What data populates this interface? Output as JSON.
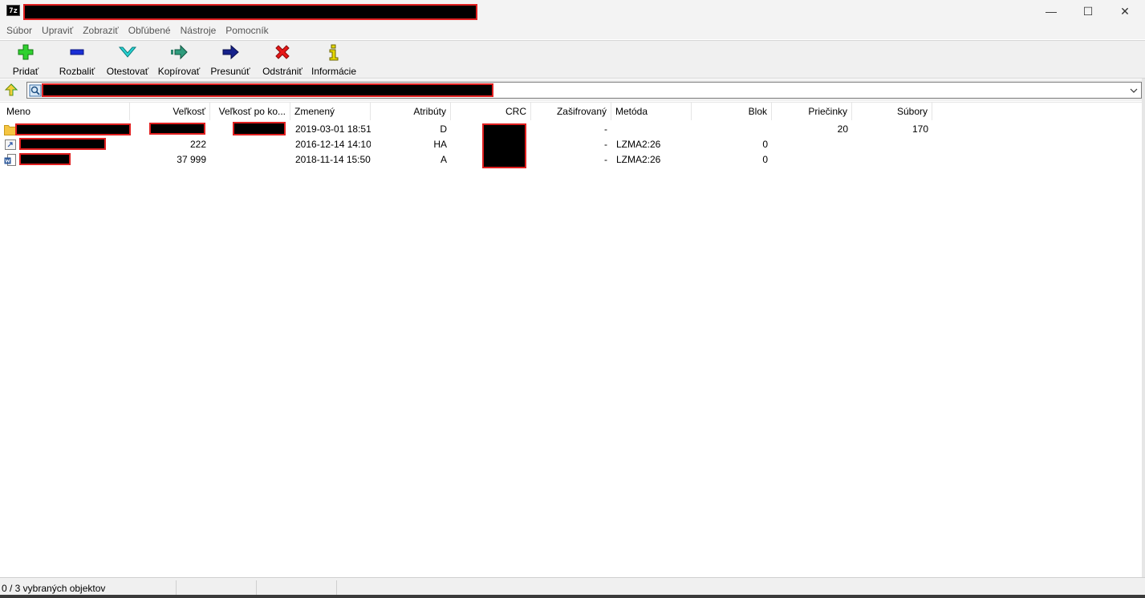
{
  "app": {
    "icon_text": "7z",
    "title": ""
  },
  "window_controls": {
    "minimize": "—",
    "maximize": "☐",
    "close": "✕"
  },
  "menu": [
    "Súbor",
    "Upraviť",
    "Zobraziť",
    "Obľúbené",
    "Nástroje",
    "Pomocník"
  ],
  "toolbar": [
    {
      "label": "Pridať",
      "icon": "plus-icon"
    },
    {
      "label": "Rozbaliť",
      "icon": "minus-icon"
    },
    {
      "label": "Otestovať",
      "icon": "check-icon"
    },
    {
      "label": "Kopírovať",
      "icon": "copy-arrow-icon"
    },
    {
      "label": "Presunúť",
      "icon": "move-arrow-icon"
    },
    {
      "label": "Odstrániť",
      "icon": "delete-x-icon"
    },
    {
      "label": "Informácie",
      "icon": "info-icon"
    }
  ],
  "address": {
    "value": ""
  },
  "columns": [
    "Meno",
    "Veľkosť",
    "Veľkosť po ko...",
    "Zmenený",
    "Atribúty",
    "CRC",
    "Zašifrovaný",
    "Metóda",
    "Blok",
    "Priečinky",
    "Súbory"
  ],
  "rows": [
    {
      "icon": "folder-icon",
      "name": "",
      "size": "",
      "packed": "",
      "modified": "2019-03-01 18:51",
      "attributes": "D",
      "crc": "",
      "encrypted": "-",
      "method": "",
      "block": "",
      "folders": "20",
      "files": "170"
    },
    {
      "icon": "shortcut-file-icon",
      "name": "",
      "size": "222",
      "packed": "",
      "modified": "2016-12-14 14:10",
      "attributes": "HA",
      "crc": "",
      "encrypted": "-",
      "method": "LZMA2:26",
      "block": "0",
      "folders": "",
      "files": ""
    },
    {
      "icon": "word-document-icon",
      "name": "",
      "size": "37 999",
      "packed": "",
      "modified": "2018-11-14 15:50",
      "attributes": "A",
      "crc": "",
      "encrypted": "-",
      "method": "LZMA2:26",
      "block": "0",
      "folders": "",
      "files": ""
    }
  ],
  "status": {
    "selection": "0 / 3 vybraných objektov"
  }
}
